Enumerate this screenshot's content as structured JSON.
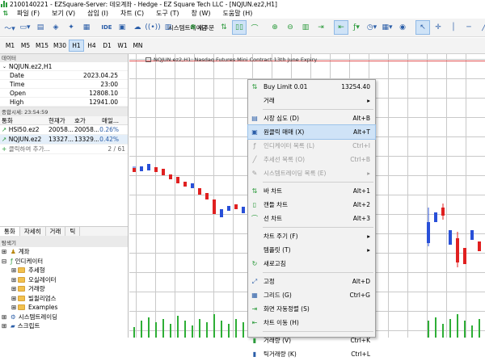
{
  "title": "2100140221 - EZSquare-Server: 데모계좌 - Hedge - EZ Square Tech LLC - [NQJUN.ez2,H1]",
  "menubar": [
    "파일 (F)",
    "보기 (V)",
    "삽입 (I)",
    "차트 (C)",
    "도구 (T)",
    "창 (W)",
    "도움말 (H)"
  ],
  "toolbar": {
    "algo_label": "시스템트레이딩",
    "new_order_label": "새주문",
    "ide_label": "IDE"
  },
  "timeframes": [
    "M1",
    "M5",
    "M15",
    "M30",
    "H1",
    "H4",
    "D1",
    "W1",
    "MN"
  ],
  "active_timeframe": "H1",
  "data_window": {
    "header": "데이터",
    "symbol": "NQJUN.ez2,H1",
    "rows": [
      {
        "k": "Date",
        "v": "2023.04.25"
      },
      {
        "k": "Time",
        "v": "23:00"
      },
      {
        "k": "Open",
        "v": "12808.10"
      },
      {
        "k": "High",
        "v": "12941.00"
      }
    ]
  },
  "market_watch": {
    "header": "종합시세: 23:54:59",
    "columns": [
      "통화",
      "현재가",
      "호가",
      "매일..."
    ],
    "rows": [
      {
        "sym": "HSI50.ez2",
        "bid": "20058...",
        "ask": "20058...",
        "chg": "0.26%"
      },
      {
        "sym": "NQJUN.ez2",
        "bid": "13327...",
        "ask": "13329...",
        "chg": "0.42%"
      }
    ],
    "add_label": "클릭하여 추가...",
    "count": "2 / 61"
  },
  "mw_tabs": [
    "통화",
    "자세히",
    "거래",
    "틱"
  ],
  "navigator": {
    "header": "탐색기",
    "items": [
      "계좌",
      "인디케이터",
      "추세형",
      "오실레이터",
      "거래량",
      "빌윌리엄스",
      "Examples",
      "시스템트레이딩",
      "스크립트"
    ]
  },
  "chart": {
    "title": "NQJUN.ez2,H1:  Nasdaq Futures Mini Contract 13th June Expiry"
  },
  "context_menu": [
    {
      "label": "Buy Limit 0.01",
      "sc": "13254.40",
      "icon": "buy-limit-icon"
    },
    {
      "label": "거래",
      "sc": "▸",
      "icon": ""
    },
    {
      "sep": true
    },
    {
      "label": "시장 심도 (D)",
      "sc": "Alt+B",
      "icon": "depth-icon"
    },
    {
      "label": "원클릭 매매 (X)",
      "sc": "Alt+T",
      "icon": "one-click-icon",
      "hl": true
    },
    {
      "label": "인디케이터 목록 (L)",
      "sc": "Ctrl+I",
      "icon": "indicator-list-icon",
      "dis": true
    },
    {
      "label": "추세선 목록 (O)",
      "sc": "Ctrl+B",
      "icon": "objects-list-icon",
      "dis": true
    },
    {
      "label": "시스템트레이딩 목록 (E)",
      "sc": "▸",
      "icon": "experts-list-icon",
      "dis": true
    },
    {
      "sep": true
    },
    {
      "label": "바 차트",
      "sc": "Alt+1",
      "icon": "bar-chart-icon"
    },
    {
      "label": "캔들 차트",
      "sc": "Alt+2",
      "icon": "candle-chart-icon"
    },
    {
      "label": "선 차트",
      "sc": "Alt+3",
      "icon": "line-chart-icon"
    },
    {
      "sep": true
    },
    {
      "label": "차트 주기 (F)",
      "sc": "▸",
      "icon": ""
    },
    {
      "label": "템플릿 (T)",
      "sc": "▸",
      "icon": ""
    },
    {
      "label": "새로고침",
      "sc": "",
      "icon": "refresh-icon"
    },
    {
      "sep": true
    },
    {
      "label": "고정",
      "sc": "Alt+D",
      "icon": "pin-icon"
    },
    {
      "label": "그리드 (G)",
      "sc": "Ctrl+G",
      "icon": "grid-icon"
    },
    {
      "label": "화면 자동정렬 (S)",
      "sc": "",
      "icon": "autoscroll-icon"
    },
    {
      "label": "차트 이동 (H)",
      "sc": "",
      "icon": "chart-shift-icon"
    },
    {
      "sep": true
    },
    {
      "label": "거래량 (V)",
      "sc": "Ctrl+K",
      "icon": "volume-icon"
    },
    {
      "label": "틱거래량 (K)",
      "sc": "Ctrl+L",
      "icon": "tick-volume-icon"
    }
  ],
  "colors": {
    "up": "#2950d8",
    "down": "#e02020",
    "volume": "#2eae36"
  }
}
